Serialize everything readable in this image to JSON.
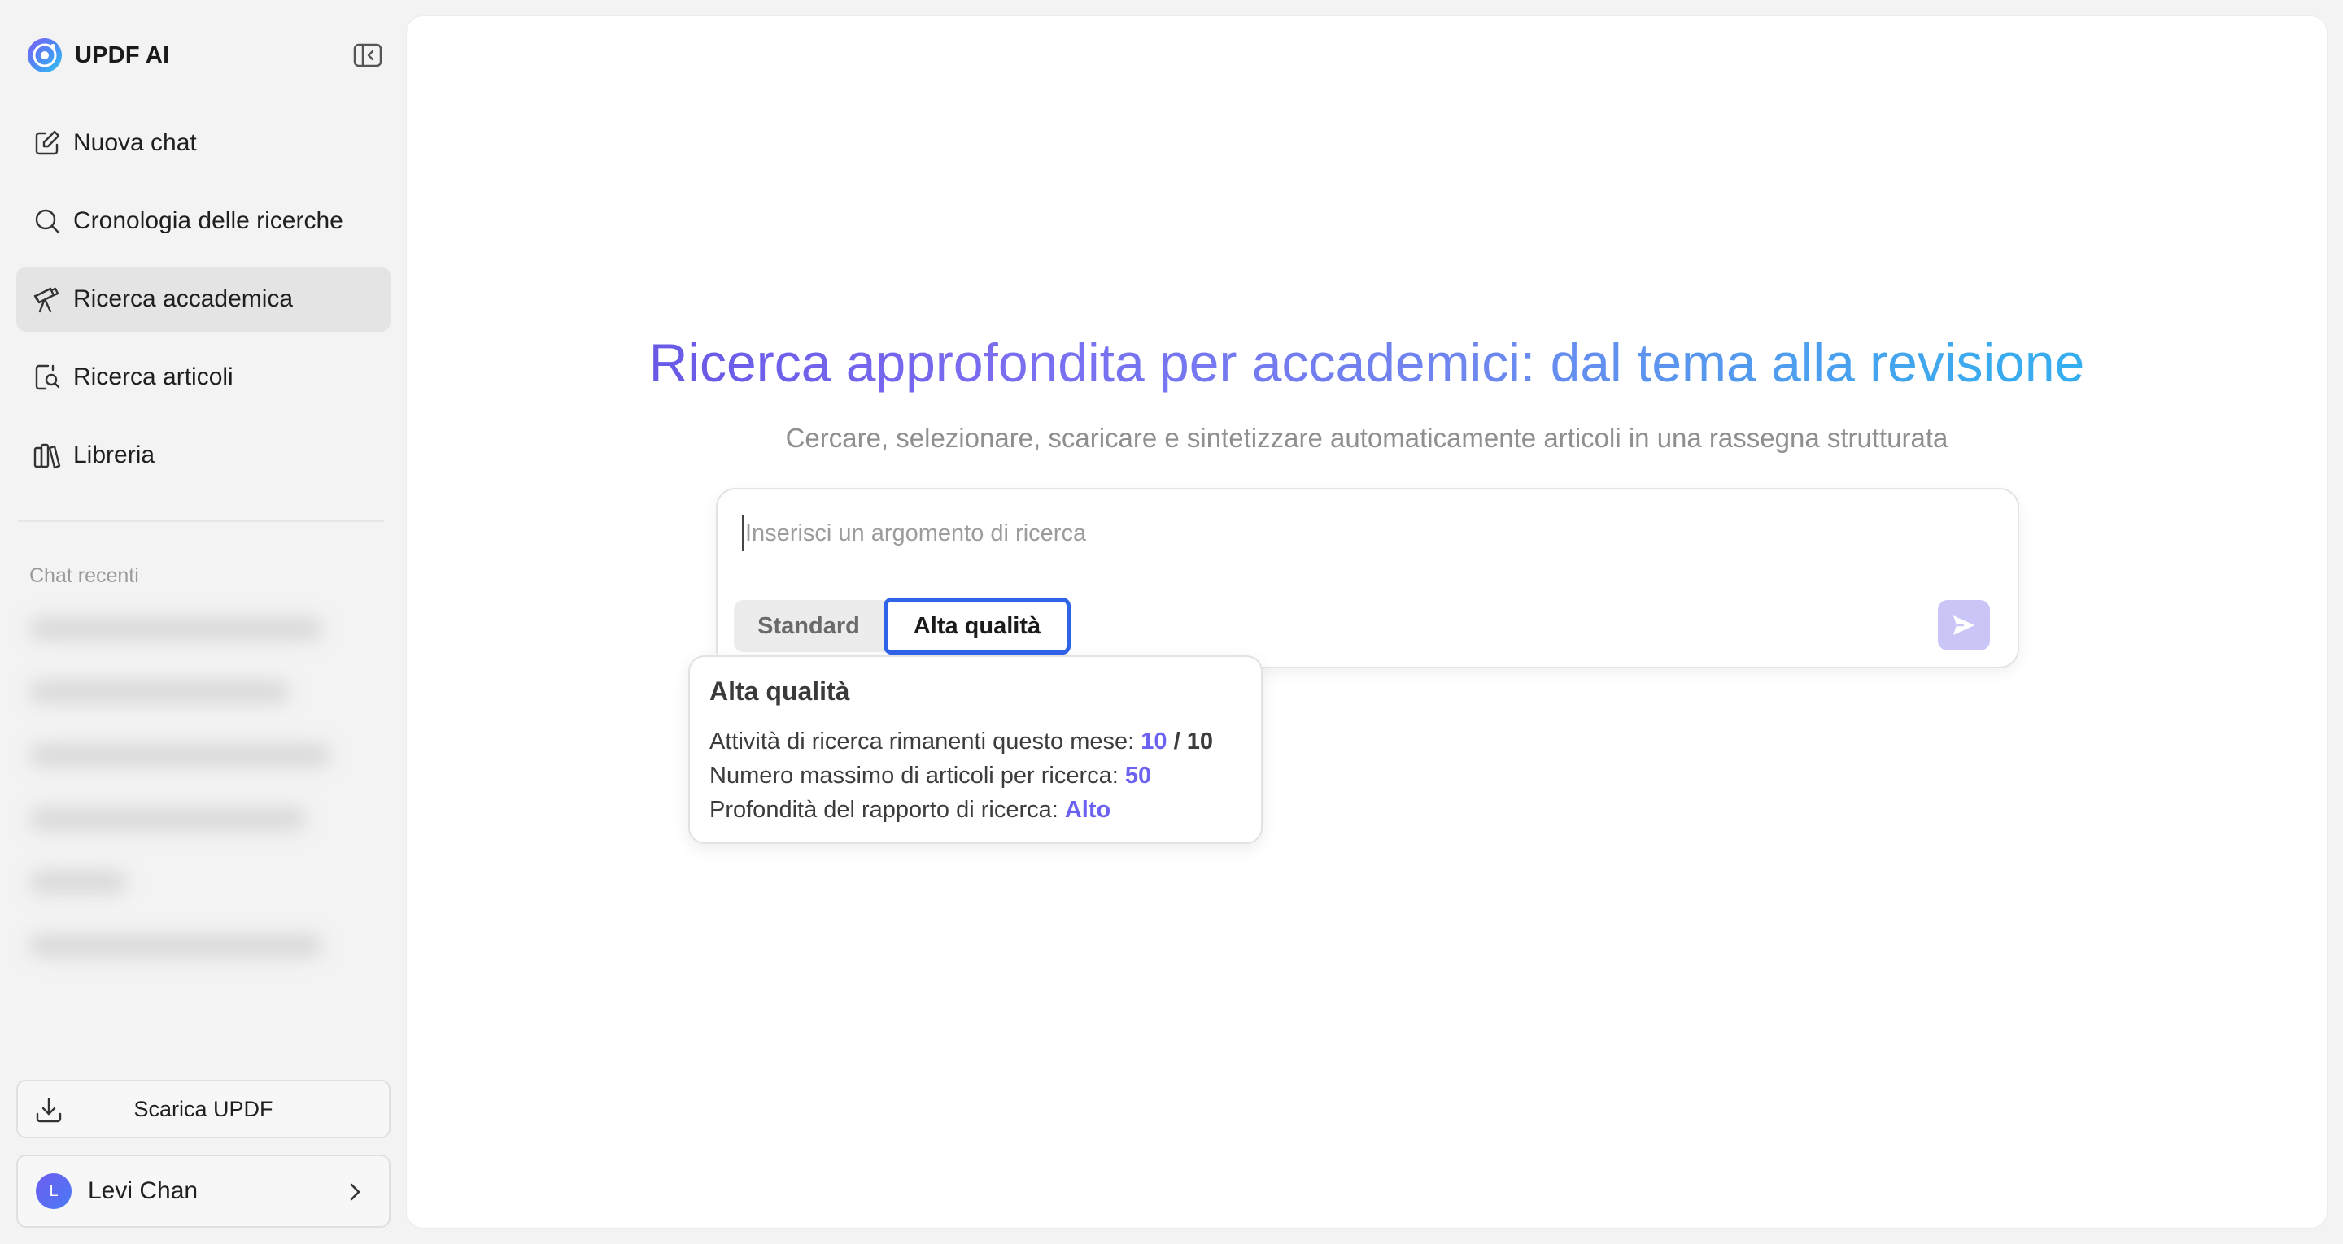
{
  "brand": {
    "name": "UPDF AI"
  },
  "sidebar": {
    "nav": [
      {
        "label": "Nuova chat",
        "icon": "edit-icon"
      },
      {
        "label": "Cronologia delle ricerche",
        "icon": "search-icon"
      },
      {
        "label": "Ricerca accademica",
        "icon": "telescope-icon",
        "active": true
      },
      {
        "label": "Ricerca articoli",
        "icon": "document-search-icon"
      },
      {
        "label": "Libreria",
        "icon": "library-icon"
      }
    ],
    "recent_title": "Chat recenti",
    "download_label": "Scarica UPDF",
    "user": {
      "initial": "L",
      "name": "Levi Chan"
    }
  },
  "main": {
    "title": "Ricerca approfondita per accademici: dal tema alla revisione",
    "subtitle": "Cercare, selezionare, scaricare e sintetizzare automaticamente articoli in una rassegna strutturata",
    "search": {
      "placeholder": "Inserisci un argomento di ricerca",
      "value": ""
    },
    "modes": {
      "standard": "Standard",
      "high_quality": "Alta qualità",
      "selected": "high_quality"
    }
  },
  "tooltip": {
    "title": "Alta qualità",
    "row1_label": "Attività di ricerca rimanenti questo mese: ",
    "row1_value": "10",
    "row1_sep": " / ",
    "row1_total": "10",
    "row2_label": "Numero massimo di articoli per ricerca: ",
    "row2_value": "50",
    "row3_label": "Profondità del rapporto di ricerca: ",
    "row3_value": "Alto"
  },
  "colors": {
    "accent": "#2f63e8",
    "value_purple": "#6b62f0",
    "send_disabled": "#c9c6f7",
    "active_nav_bg": "#e4e4e4"
  }
}
